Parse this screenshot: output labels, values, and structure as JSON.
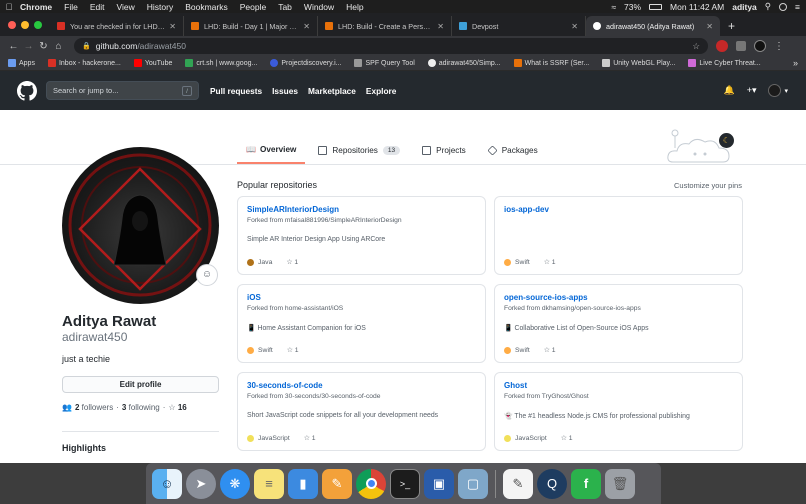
{
  "mac_menu": {
    "app": "Chrome",
    "items": [
      "File",
      "Edit",
      "View",
      "History",
      "Bookmarks",
      "People",
      "Tab",
      "Window",
      "Help"
    ],
    "battery": "73%",
    "clock": "Mon 11:42 AM",
    "user": "aditya"
  },
  "tabs": [
    {
      "title": "You are checked in for LHD: Bu",
      "favicon_color": "#d93025"
    },
    {
      "title": "LHD: Build - Day 1 | Major Lea",
      "favicon_color": "#e8710a"
    },
    {
      "title": "LHD: Build - Create a Personal",
      "favicon_color": "#e8710a"
    },
    {
      "title": "Devpost",
      "favicon_color": "#3ea0d8"
    },
    {
      "title": "adirawat450 (Aditya Rawat)",
      "favicon_color": "#ffffff"
    }
  ],
  "address": {
    "host": "github.com",
    "path": "/adirawat450"
  },
  "bookmarks": [
    {
      "label": "Apps",
      "color": "#6b9cf0"
    },
    {
      "label": "Inbox - hackerone...",
      "color": "#d93025"
    },
    {
      "label": "YouTube",
      "color": "#ff0000"
    },
    {
      "label": "crt.sh | www.goog...",
      "color": "#31a354"
    },
    {
      "label": "Projectdiscovery.i...",
      "color": "#3b5bdb"
    },
    {
      "label": "SPF Query Tool",
      "color": "#999999"
    },
    {
      "label": "adirawat450/Simp...",
      "color": "#eeeeee"
    },
    {
      "label": "What is SSRF (Ser...",
      "color": "#e8710a"
    },
    {
      "label": "Unity WebGL Play...",
      "color": "#cccccc"
    },
    {
      "label": "Live Cyber Threat...",
      "color": "#d06ad8"
    }
  ],
  "github_header": {
    "search_placeholder": "Search or jump to...",
    "search_key": "/",
    "nav": [
      "Pull requests",
      "Issues",
      "Marketplace",
      "Explore"
    ]
  },
  "profile_tabs": [
    {
      "label": "Overview",
      "selected": true,
      "icon": "book-icon"
    },
    {
      "label": "Repositories",
      "count": "13",
      "icon": "repo-icon"
    },
    {
      "label": "Projects",
      "icon": "project-icon"
    },
    {
      "label": "Packages",
      "icon": "package-icon"
    }
  ],
  "profile": {
    "name": "Aditya Rawat",
    "login": "adirawat450",
    "bio": "just a techie",
    "edit_label": "Edit profile",
    "followers": "2",
    "followers_label": "followers",
    "following": "3",
    "following_label": "following",
    "stars": "16",
    "highlights_title": "Highlights"
  },
  "popular": {
    "title": "Popular repositories",
    "customize": "Customize your pins"
  },
  "repos": [
    {
      "name": "SimpleARInteriorDesign",
      "fork": "Forked from mfaisal881996/SimpleARInteriorDesign",
      "desc": "Simple AR Interior Design App Using ARCore",
      "lang": "Java",
      "lang_color": "#b07219",
      "stars": "1"
    },
    {
      "name": "ios-app-dev",
      "fork": "",
      "desc": "",
      "lang": "Swift",
      "lang_color": "#ffac45",
      "stars": "1"
    },
    {
      "name": "iOS",
      "fork": "Forked from home-assistant/iOS",
      "desc": "📱 Home Assistant Companion for iOS",
      "lang": "Swift",
      "lang_color": "#ffac45",
      "stars": "1"
    },
    {
      "name": "open-source-ios-apps",
      "fork": "Forked from dkhamsing/open-source-ios-apps",
      "desc": "📱 Collaborative List of Open-Source iOS Apps",
      "lang": "Swift",
      "lang_color": "#ffac45",
      "stars": "1"
    },
    {
      "name": "30-seconds-of-code",
      "fork": "Forked from 30-seconds/30-seconds-of-code",
      "desc": "Short JavaScript code snippets for all your development needs",
      "lang": "JavaScript",
      "lang_color": "#f1e05a",
      "stars": "1"
    },
    {
      "name": "Ghost",
      "fork": "Forked from TryGhost/Ghost",
      "desc": "👻 The #1 headless Node.js CMS for professional publishing",
      "lang": "JavaScript",
      "lang_color": "#f1e05a",
      "stars": "1"
    }
  ],
  "dock": [
    "finder-icon",
    "launchpad-icon",
    "safari-icon",
    "notes-icon",
    "keynote-icon",
    "pages-icon",
    "chrome-icon",
    "terminal-icon",
    "virtualbox-icon",
    "preview-icon",
    "textedit-icon",
    "quicktime-icon",
    "feedly-icon",
    "trash-icon"
  ]
}
